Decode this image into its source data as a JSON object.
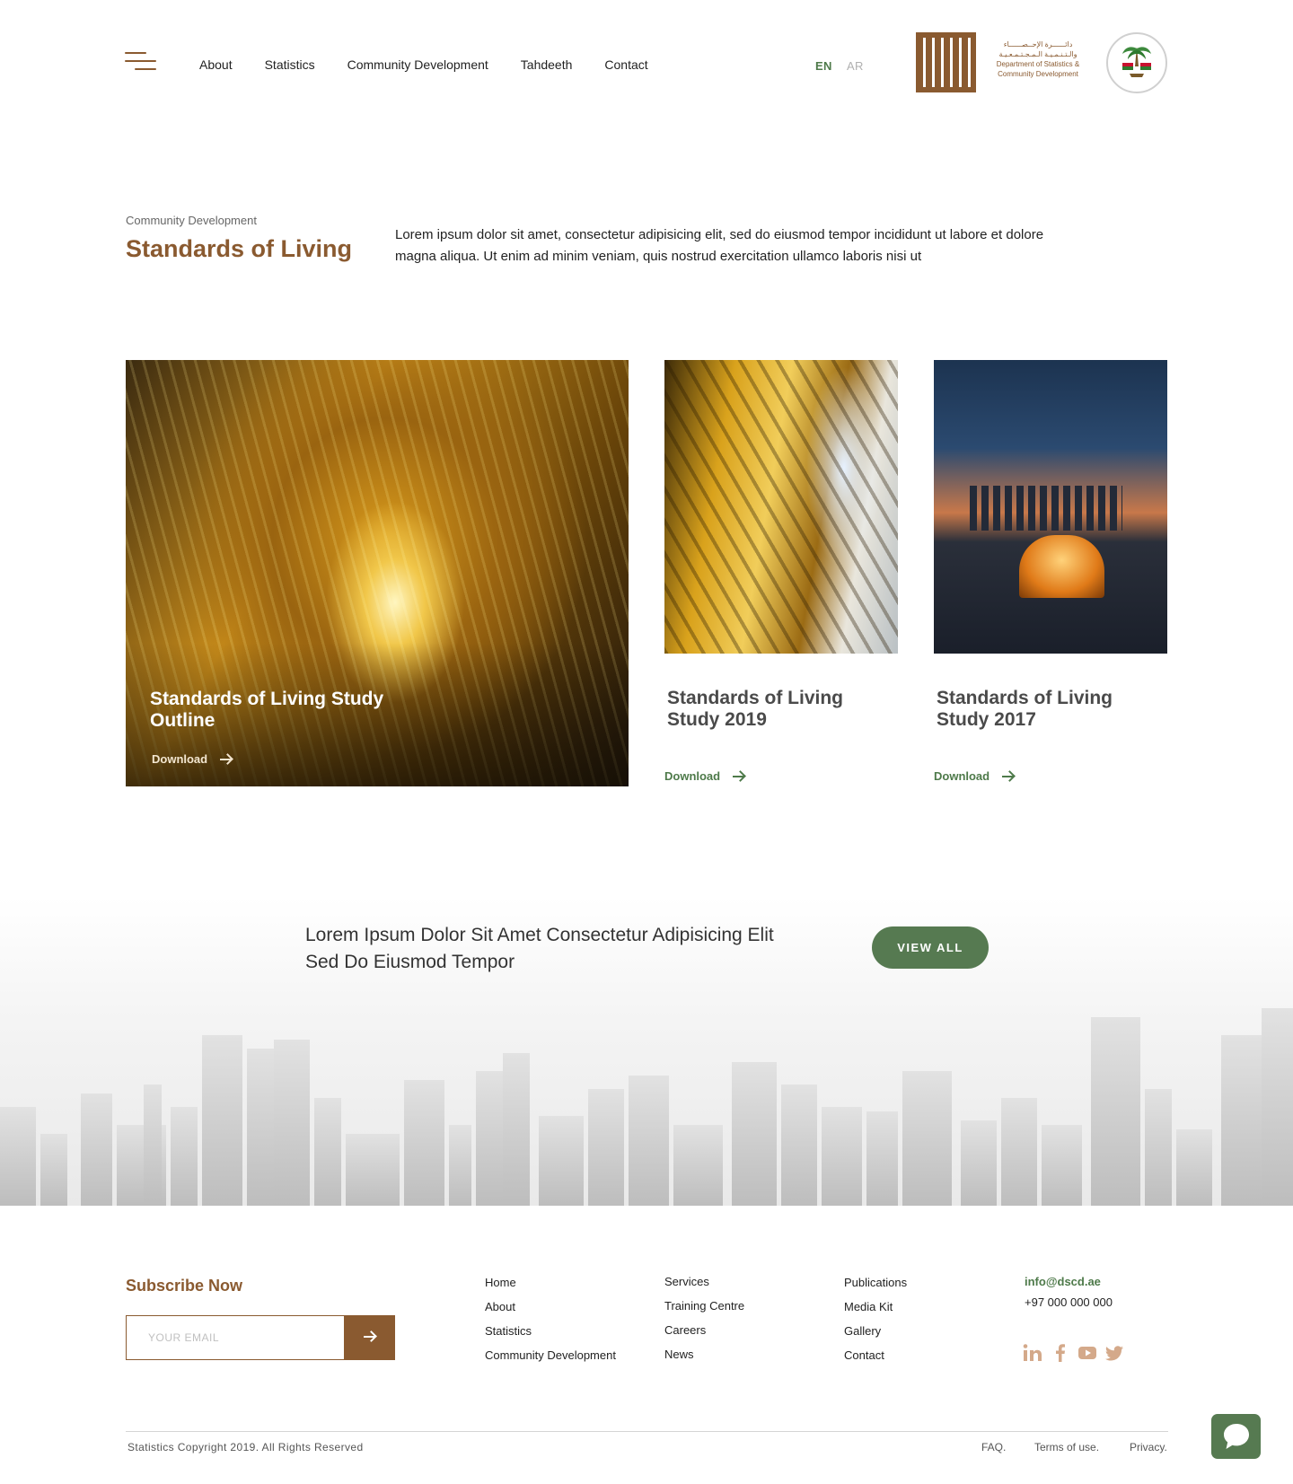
{
  "header": {
    "menu_icon": "menu-icon",
    "nav": [
      "About",
      "Statistics",
      "Community Development",
      "Tahdeeth",
      "Contact"
    ],
    "lang_en": "EN",
    "lang_ar": "AR",
    "logo_text_ar_1": "دائــــــرة الإحــصــــــاء",
    "logo_text_ar_2": "والـتـنـمـيـة الـمـجـتـمـعـيـة",
    "logo_text_en_1": "Department of Statistics &",
    "logo_text_en_2": "Community Development"
  },
  "intro": {
    "eyebrow": "Community Development",
    "title": "Standards of Living",
    "body": "Lorem ipsum dolor sit amet, consectetur adipisicing elit, sed do eiusmod tempor incididunt ut labore et dolore magna aliqua. Ut enim ad minim veniam, quis nostrud exercitation ullamco laboris nisi ut"
  },
  "cards": [
    {
      "title": "Standards of Living Study Outline",
      "link": "Download"
    },
    {
      "title": "Standards of Living Study 2019",
      "link": "Download"
    },
    {
      "title": "Standards of Living Study 2017",
      "link": "Download"
    }
  ],
  "cta": {
    "text": "Lorem Ipsum Dolor Sit Amet Consectetur Adipisicing Elit Sed Do Eiusmod Tempor",
    "button": "VIEW ALL"
  },
  "footer": {
    "subscribe_title": "Subscribe Now",
    "email_placeholder": "YOUR EMAIL",
    "col1": [
      "Home",
      "About",
      "Statistics",
      "Community Development"
    ],
    "col2": [
      "Services",
      "Training Centre",
      "Careers",
      "News"
    ],
    "col3": [
      "Publications",
      "Media Kit",
      "Gallery",
      "Contact"
    ],
    "email": "info@dscd.ae",
    "phone": "+97 000 000 000",
    "social": [
      "linkedin-icon",
      "facebook-icon",
      "youtube-icon",
      "twitter-icon"
    ],
    "copyright": "Statistics Copyright 2019. All Rights Reserved",
    "legal": [
      "FAQ.",
      "Terms of use.",
      "Privacy."
    ]
  },
  "colors": {
    "brand_brown": "#8a5a30",
    "brand_green": "#567a51",
    "social_tan": "#d4a98a"
  }
}
